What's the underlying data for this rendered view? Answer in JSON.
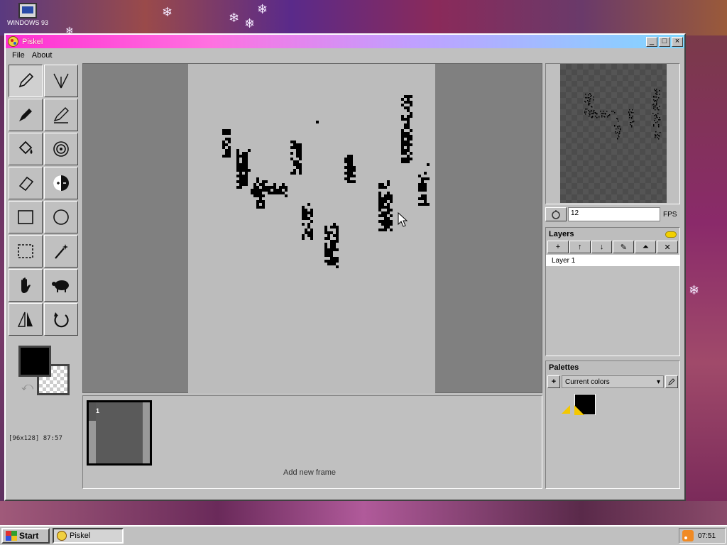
{
  "desktop": {
    "icon_label": "WINDOWS 93"
  },
  "window": {
    "title": "Piskel",
    "menu": [
      "File",
      "About"
    ],
    "controls": {
      "minimize": "_",
      "maximize": "□",
      "close": "×"
    }
  },
  "tools": [
    {
      "name": "pen-tool",
      "icon": "pencil-icon",
      "active": true
    },
    {
      "name": "mirror-pen-tool",
      "icon": "vertical-mirror-pen-icon",
      "active": false
    },
    {
      "name": "eyedropper-pen-tool",
      "icon": "paint-brush-icon",
      "active": false
    },
    {
      "name": "stroke-tool",
      "icon": "stroke-pen-icon",
      "active": false
    },
    {
      "name": "paint-bucket-tool",
      "icon": "paint-bucket-icon",
      "active": false
    },
    {
      "name": "color-swap-tool",
      "icon": "target-icon",
      "active": false
    },
    {
      "name": "eraser-tool",
      "icon": "eraser-icon",
      "active": false
    },
    {
      "name": "lighten-tool",
      "icon": "lighten-icon",
      "active": false
    },
    {
      "name": "rectangle-tool",
      "icon": "rectangle-icon",
      "active": false
    },
    {
      "name": "circle-tool",
      "icon": "circle-icon",
      "active": false
    },
    {
      "name": "rect-select-tool",
      "icon": "dashed-rect-icon",
      "active": false
    },
    {
      "name": "magic-wand-tool",
      "icon": "magic-wand-icon",
      "active": false
    },
    {
      "name": "move-tool",
      "icon": "hand-icon",
      "active": false
    },
    {
      "name": "dithering-tool",
      "icon": "sheep-icon",
      "active": false
    },
    {
      "name": "flip-tool",
      "icon": "flip-icon",
      "active": false
    },
    {
      "name": "rotate-tool",
      "icon": "rotate-icon",
      "active": false
    }
  ],
  "colors": {
    "primary": "#000000",
    "secondary": "transparent"
  },
  "status": {
    "coords": "[96x128] 87:57"
  },
  "frames": {
    "items": [
      {
        "number": "1"
      }
    ],
    "add_label": "Add new frame"
  },
  "preview": {
    "fps": "12",
    "fps_label": "FPS"
  },
  "layers": {
    "title": "Layers",
    "buttons": [
      "+",
      "↑",
      "↓",
      "✎",
      "⏶",
      "✕"
    ],
    "items": [
      {
        "label": "Layer 1"
      }
    ]
  },
  "palettes": {
    "title": "Palettes",
    "add": "+",
    "selected": "Current colors",
    "swatches": [
      "#000000"
    ]
  },
  "taskbar": {
    "start_label": "Start",
    "task_label": "Piskel",
    "clock": "07:51"
  },
  "accent": {
    "titlebar_start": "#ff2fd2",
    "titlebar_end": "#80d8ff"
  }
}
